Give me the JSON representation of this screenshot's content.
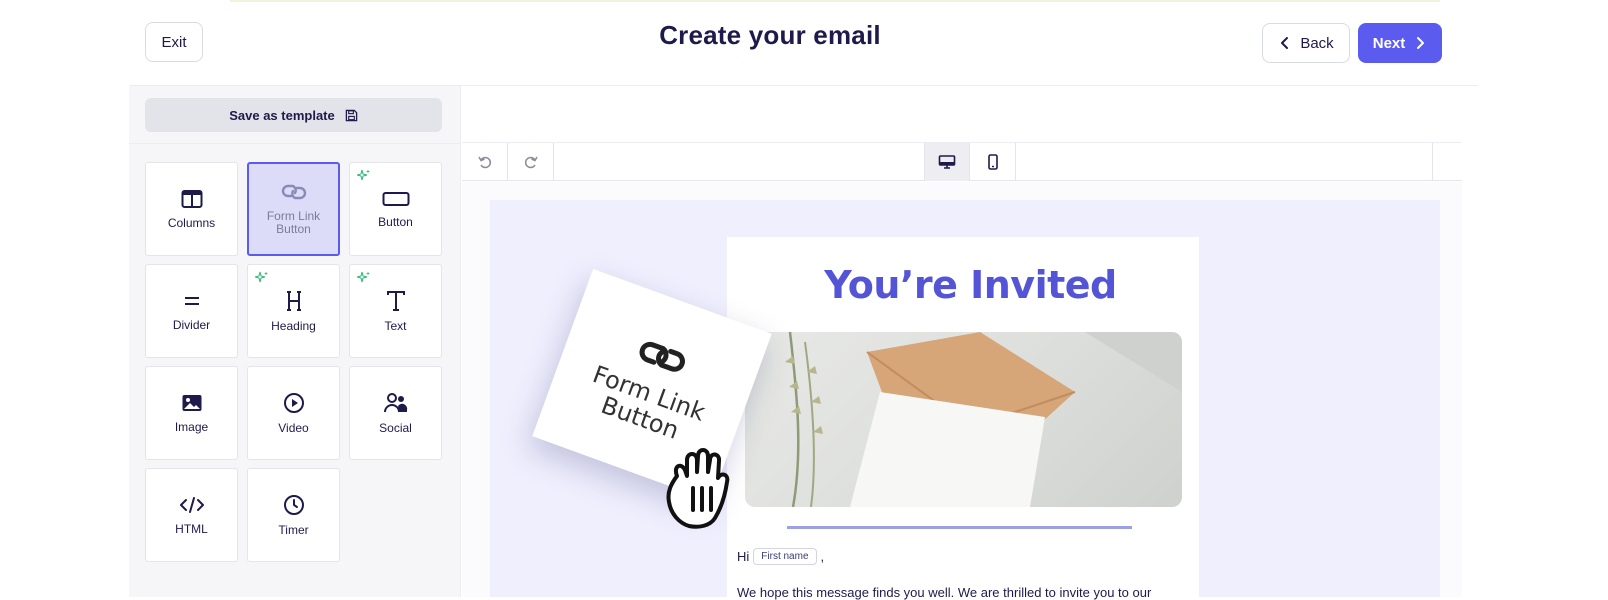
{
  "header": {
    "exit_label": "Exit",
    "title": "Create your email",
    "back_label": "Back",
    "next_label": "Next"
  },
  "sidebar": {
    "save_template_label": "Save as template",
    "blocks": [
      {
        "label": "Columns",
        "icon": "columns-icon"
      },
      {
        "label": "Form Link Button",
        "icon": "link-icon",
        "active": true
      },
      {
        "label": "Button",
        "icon": "button-icon",
        "ai": true
      },
      {
        "label": "Divider",
        "icon": "divider-icon"
      },
      {
        "label": "Heading",
        "icon": "heading-icon",
        "ai": true
      },
      {
        "label": "Text",
        "icon": "text-icon",
        "ai": true
      },
      {
        "label": "Image",
        "icon": "image-icon"
      },
      {
        "label": "Video",
        "icon": "video-icon"
      },
      {
        "label": "Social",
        "icon": "social-icon"
      },
      {
        "label": "HTML",
        "icon": "code-icon"
      },
      {
        "label": "Timer",
        "icon": "clock-icon"
      }
    ]
  },
  "toolbar": {
    "undo_icon": "undo-icon",
    "redo_icon": "redo-icon",
    "desktop_icon": "desktop-icon",
    "mobile_icon": "mobile-icon"
  },
  "email": {
    "heading": "You’re Invited",
    "greeting": "Hi",
    "merge_tag": "First name",
    "greeting_suffix": ",",
    "body_line": "We hope this message finds you well. We are thrilled to invite you to our"
  },
  "drag_preview": {
    "label": "Form Link Button"
  },
  "colors": {
    "accent": "#5b5bf0",
    "heading": "#5454d6",
    "canvas_bg": "#efeffe",
    "ai_sparkle": "#2bb673"
  }
}
